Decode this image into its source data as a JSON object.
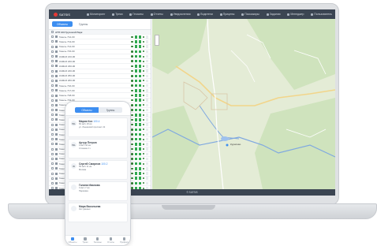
{
  "app": {
    "brand": "SATSIS",
    "footer": "© SATSIS"
  },
  "nav": [
    "Мониторинг",
    "Треки",
    "Геозоны",
    "Отчеты",
    "Уведомления",
    "Водители",
    "Прицепы",
    "Пассажиры",
    "Задания",
    "Менеджер",
    "Пользователь"
  ],
  "sidebar": {
    "tabs": [
      "Объекты",
      "Группы"
    ],
    "group": "АТП 123 Грузовой Парк",
    "rows": [
      "Газель 712-00",
      "Газель 713-00",
      "Газель 714-00",
      "Газель 715-00",
      "КАМАЗ 210-00",
      "КАМАЗ 220-00",
      "КАМАЗ 230-00",
      "КАМАЗ 240-00",
      "КАМАЗ 250-00",
      "КАМАЗ 260-00",
      "Газель 716-00",
      "Газель 717-00",
      "Газель 718-00",
      "Газель 719-00",
      "Газель 720-00",
      "Газель 721-00",
      "Газель 722-00",
      "Газель 723-00",
      "Газель 724-00",
      "Газель 725-00",
      "Газель 726-00",
      "Газель 727-00",
      "Газель 728-00",
      "Газель 729-00",
      "Газель 730-00",
      "Газель 731-00",
      "Газель 732-00",
      "Газель 733-00",
      "Газель 734-00",
      "Газель 735-00",
      "Газель 736-00",
      "Газель 737-00",
      "Газель 738-00"
    ]
  },
  "map": {
    "place": "Курилово"
  },
  "phone": {
    "tabs": [
      "Объекты",
      "Группы"
    ],
    "cards": [
      {
        "avatar": "WL",
        "name": "Мария Кох",
        "tag": "100.4",
        "l1": "60 км/ч  18 км",
        "l2": "ул. Ленинский проспект 22"
      },
      {
        "avatar": "WL",
        "name": "Артур Петров",
        "tag": "",
        "l1": "0 км/ч  42 км",
        "l2": "Стоянка 2 ч"
      },
      {
        "avatar": "W",
        "name": "Сергей Смирнов",
        "tag": "100.2",
        "l1": "55 км/ч  11 км",
        "l2": "Москва"
      },
      {
        "avatar": "",
        "name": "Галина Иванова",
        "tag": "",
        "l1": "0 км/ч  7 км",
        "l2": "Парковка"
      },
      {
        "avatar": "",
        "name": "Мира Васильева",
        "tag": "",
        "l1": "Нет данных",
        "l2": ""
      }
    ],
    "bottom": [
      "Объекты",
      "Треки",
      "Геозоны",
      "Отчеты",
      "Профиль"
    ]
  }
}
